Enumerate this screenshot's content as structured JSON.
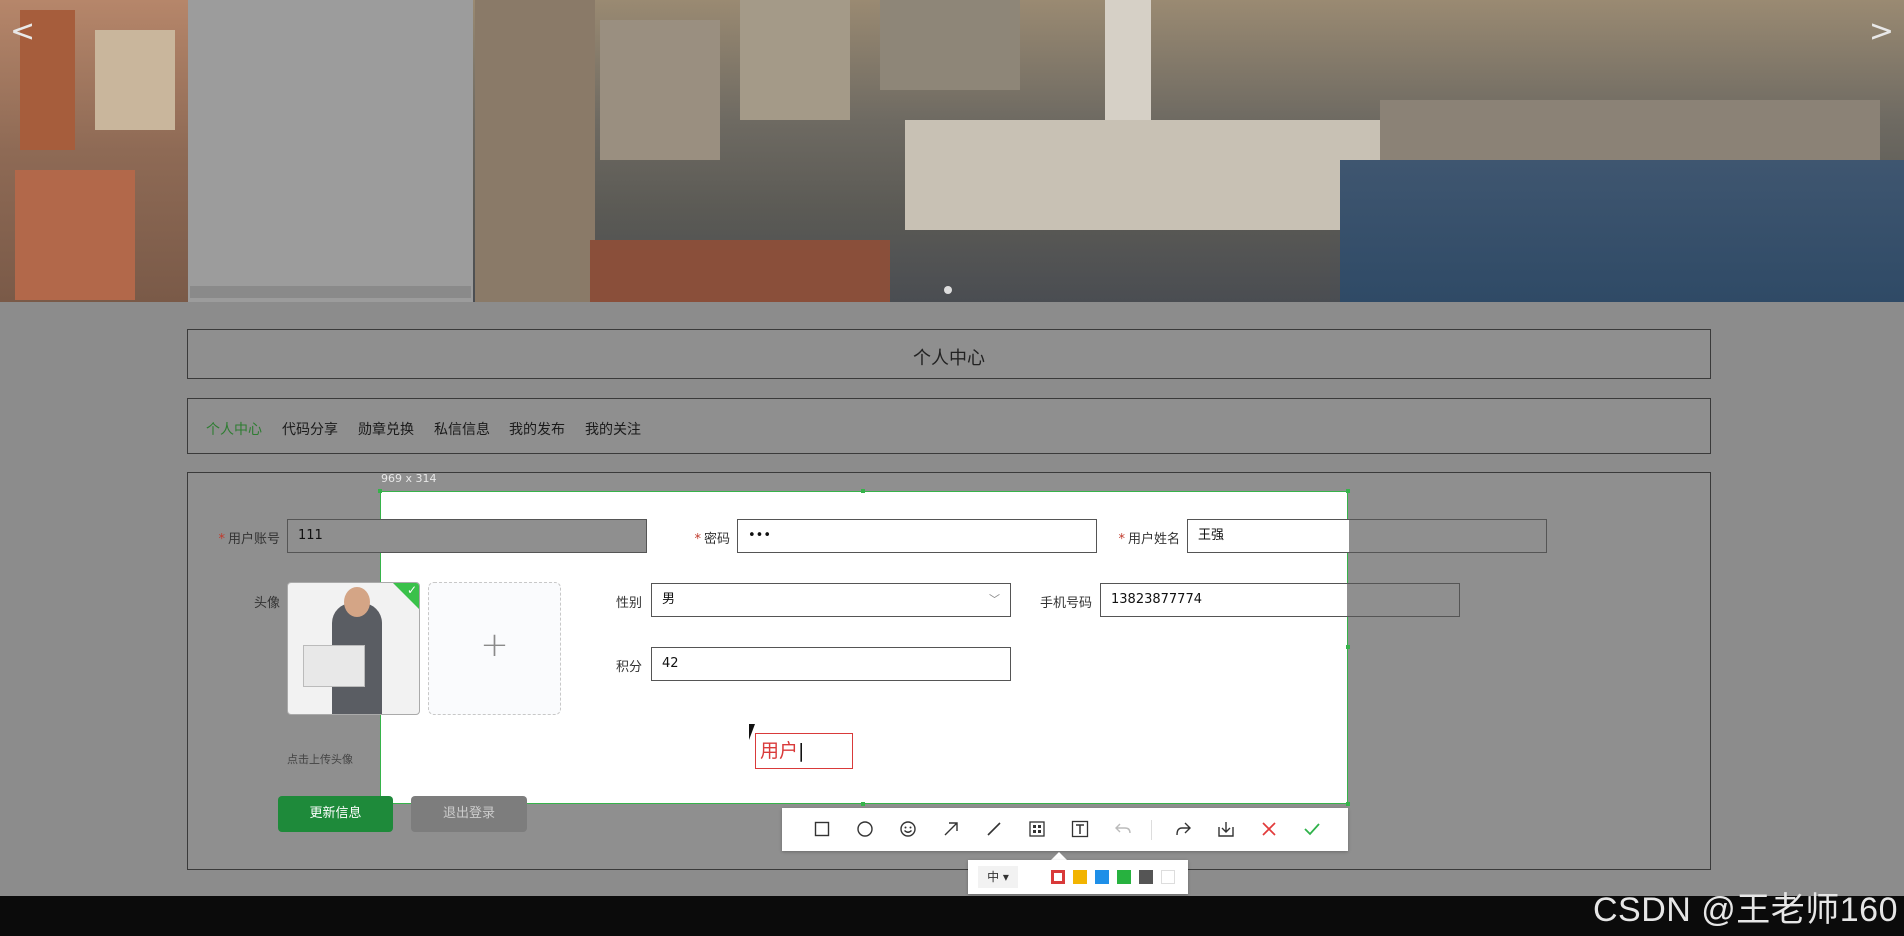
{
  "banner": {
    "prev_arrow": "<",
    "next_arrow": ">"
  },
  "title_panel": {
    "title": "个人中心"
  },
  "nav": {
    "items": [
      {
        "label": "个人中心",
        "active": true
      },
      {
        "label": "代码分享",
        "active": false
      },
      {
        "label": "勋章兑换",
        "active": false
      },
      {
        "label": "私信信息",
        "active": false
      },
      {
        "label": "我的发布",
        "active": false
      },
      {
        "label": "我的关注",
        "active": false
      }
    ]
  },
  "form": {
    "account": {
      "label": "用户账号",
      "value": "111",
      "required": "*"
    },
    "password": {
      "label": "密码",
      "value": "•••",
      "required": "*"
    },
    "name": {
      "label": "用户姓名",
      "value": "王强",
      "required": "*"
    },
    "avatar_label": "头像",
    "gender": {
      "label": "性别",
      "value": "男"
    },
    "phone": {
      "label": "手机号码",
      "value": "13823877774"
    },
    "points": {
      "label": "积分",
      "value": "42"
    },
    "upload_plus": "+",
    "upload_hint": "点击上传头像",
    "update_button": "更新信息",
    "logout_button": "退出登录"
  },
  "screenshot_tool": {
    "selection_size": "969 x 314",
    "text_annotation": "用户",
    "font_size_option": "中 ▾",
    "colors": [
      "#d93a3a",
      "#f2b400",
      "#1e8fe8",
      "#27b23f",
      "#555555",
      "#ffffff"
    ],
    "selected_color": "#d93a3a",
    "tools": [
      "rectangle-icon",
      "ellipse-icon",
      "emoji-icon",
      "arrow-icon",
      "pen-icon",
      "mosaic-icon",
      "text-icon",
      "undo-icon",
      "share-icon",
      "download-icon",
      "cancel-icon",
      "confirm-icon"
    ]
  },
  "watermark": "CSDN @王老师160"
}
